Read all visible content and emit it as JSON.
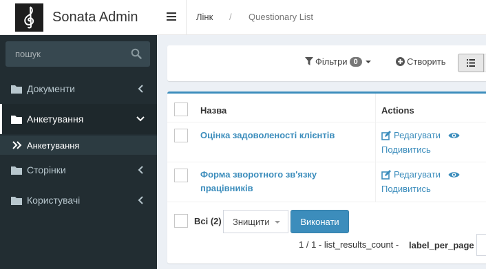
{
  "app": {
    "title": "Sonata Admin"
  },
  "sidebar": {
    "search_placeholder": "пошук",
    "items": [
      {
        "label": "Документи"
      },
      {
        "label": "Анкетування"
      },
      {
        "label": "Сторінки"
      },
      {
        "label": "Користувачі"
      }
    ],
    "sub_item": {
      "label": "Анкетування"
    }
  },
  "header": {
    "breadcrumbs": [
      "Лінк",
      "Questionary List"
    ],
    "crumb_separator": "/"
  },
  "toolbar": {
    "filters_label": "Фільтри",
    "filters_count": "0",
    "create_label": "Створить"
  },
  "table": {
    "columns": [
      "Назва",
      "Actions"
    ],
    "rows": [
      {
        "name": "Оцінка задоволеності клієнтів",
        "edit": "Редагувати",
        "view": "Подивитись"
      },
      {
        "name": "Форма зворотного зв'язку працівників",
        "edit": "Редагувати",
        "view": "Подивитись"
      }
    ],
    "all_label": "Всі (2)",
    "batch_action": "Знищити",
    "execute_label": "Виконати",
    "pager_text": "1 / 1 - list_results_count -",
    "per_page_label": "label_per_page"
  },
  "colors": {
    "sidebar_bg": "#222d32",
    "accent": "#3c8dbc",
    "page_bg": "#ecf0f5"
  }
}
